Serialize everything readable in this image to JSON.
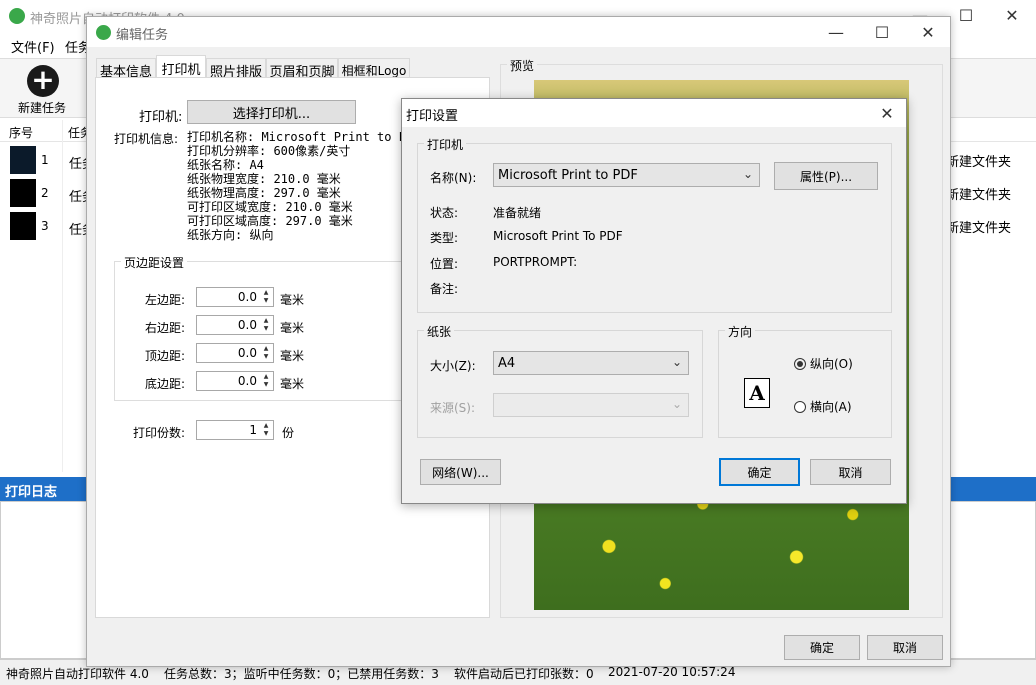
{
  "main": {
    "title": "神奇照片自动打印软件 4.0",
    "menu": [
      "文件(F)",
      "任务"
    ],
    "toolbar": {
      "new_task": "新建任务"
    },
    "table": {
      "headers": [
        "序号",
        "任务"
      ],
      "rows": [
        {
          "index": "1",
          "name": "任务",
          "folder": "新建文件夹"
        },
        {
          "index": "2",
          "name": "任务",
          "folder": "新建文件夹"
        },
        {
          "index": "3",
          "name": "任务",
          "folder": "新建文件夹"
        }
      ]
    },
    "log_title": "打印日志",
    "status": [
      "神奇照片自动打印软件 4.0",
      "任务总数：3；监听中任务数：0；已禁用任务数：3",
      "软件启动后已打印张数：0",
      "2021-07-20 10:57:24"
    ]
  },
  "edit": {
    "title": "编辑任务",
    "tabs": [
      "基本信息",
      "打印机",
      "照片排版",
      "页眉和页脚",
      "相框和Logo"
    ],
    "active_tab": 1,
    "printer_label": "打印机:",
    "select_printer": "选择打印机...",
    "info_label": "打印机信息:",
    "info": [
      "打印机名称: Microsoft Print to PDF",
      "打印机分辨率: 600像素/英寸",
      "纸张名称: A4",
      "纸张物理宽度: 210.0 毫米",
      "纸张物理高度: 297.0 毫米",
      "可打印区域宽度: 210.0 毫米",
      "可打印区域高度: 297.0 毫米",
      "纸张方向: 纵向"
    ],
    "margin_group": "页边距设置",
    "margins": [
      {
        "label": "左边距:",
        "value": "0.0",
        "unit": "毫米"
      },
      {
        "label": "右边距:",
        "value": "0.0",
        "unit": "毫米"
      },
      {
        "label": "顶边距:",
        "value": "0.0",
        "unit": "毫米"
      },
      {
        "label": "底边距:",
        "value": "0.0",
        "unit": "毫米"
      }
    ],
    "copies_label": "打印份数:",
    "copies_value": "1",
    "copies_unit": "份",
    "preview_label": "预览",
    "ok": "确定",
    "cancel": "取消"
  },
  "print": {
    "title": "打印设置",
    "printer_group": "打印机",
    "name_label": "名称(N):",
    "name_value": "Microsoft Print to PDF",
    "props": "属性(P)...",
    "status_label": "状态:",
    "status_value": "准备就绪",
    "type_label": "类型:",
    "type_value": "Microsoft Print To PDF",
    "where_label": "位置:",
    "where_value": "PORTPROMPT:",
    "comment_label": "备注:",
    "paper_group": "纸张",
    "size_label": "大小(Z):",
    "size_value": "A4",
    "source_label": "来源(S):",
    "orient_group": "方向",
    "portrait": "纵向(O)",
    "landscape": "横向(A)",
    "orient_glyph": "A",
    "network": "网络(W)...",
    "ok": "确定",
    "cancel": "取消"
  }
}
